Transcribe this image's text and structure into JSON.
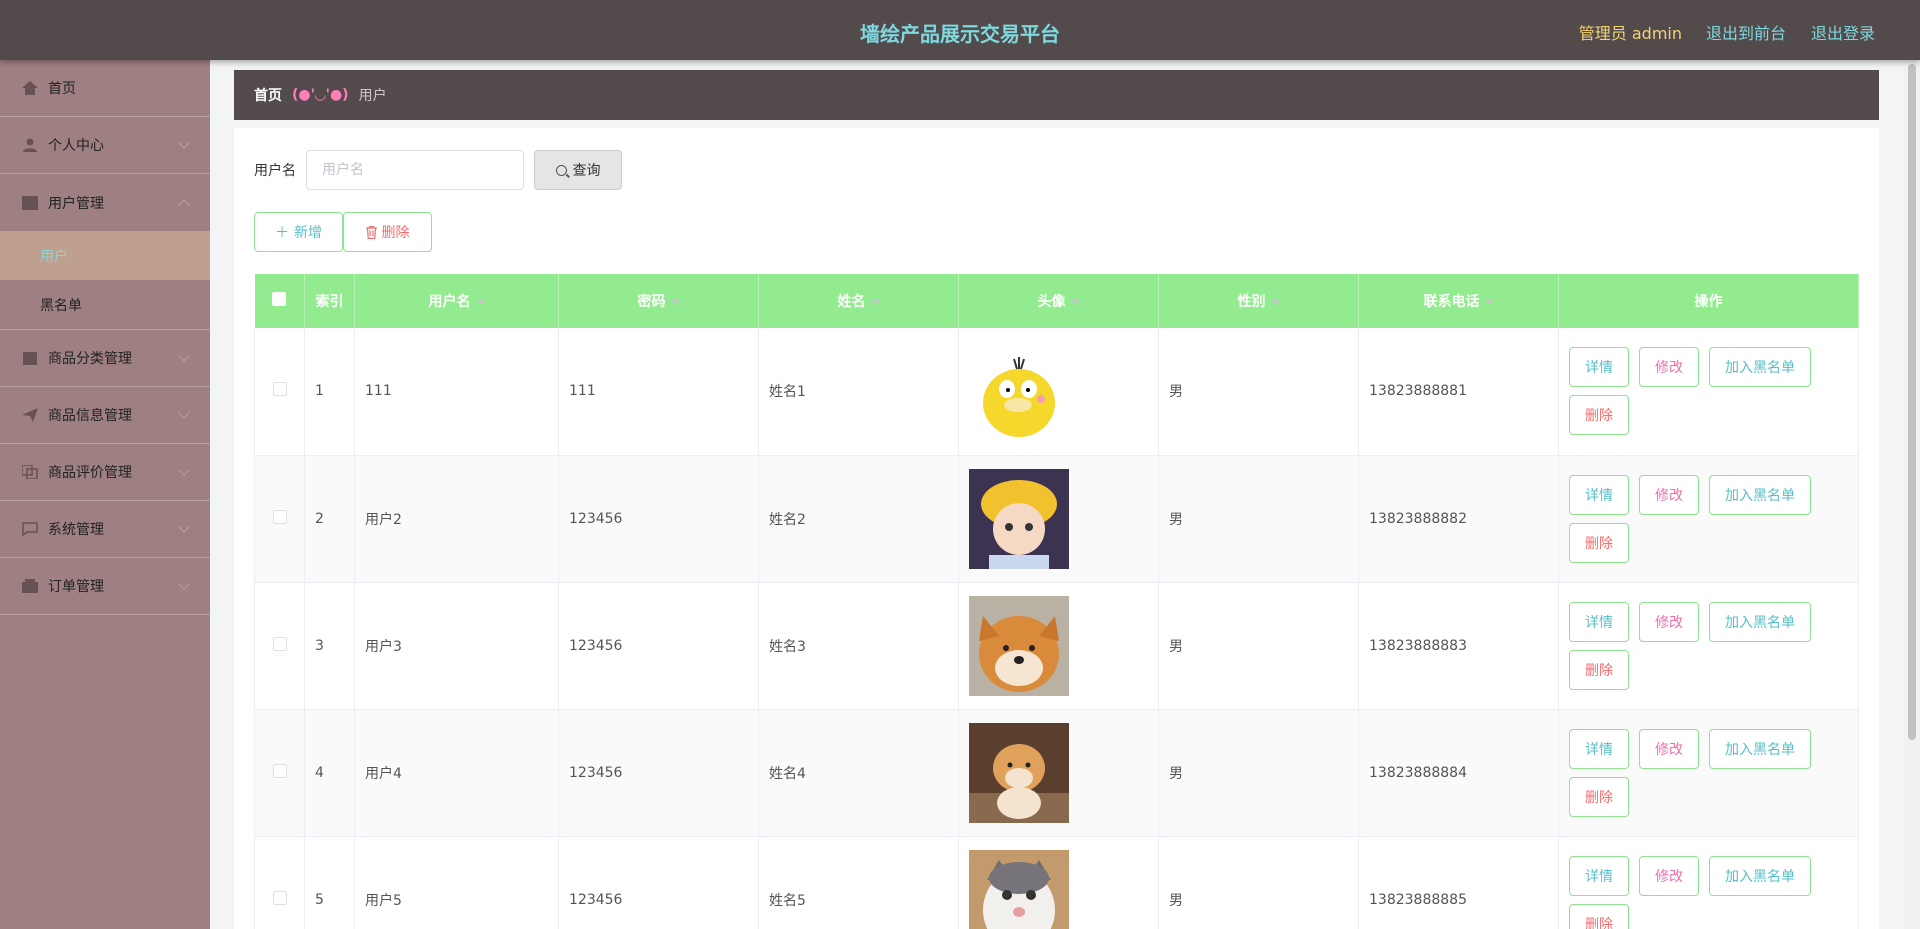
{
  "header": {
    "title": "墙绘产品展示交易平台",
    "user": "管理员 admin",
    "front_link": "退出到前台",
    "logout_link": "退出登录"
  },
  "sidebar": {
    "items": [
      {
        "label": "首页",
        "icon": "home-icon"
      },
      {
        "label": "个人中心",
        "icon": "user-icon"
      },
      {
        "label": "用户管理",
        "icon": "table-icon",
        "children": [
          "用户",
          "黑名单"
        ]
      },
      {
        "label": "商品分类管理",
        "icon": "building-icon"
      },
      {
        "label": "商品信息管理",
        "icon": "send-icon"
      },
      {
        "label": "商品评价管理",
        "icon": "copy-icon"
      },
      {
        "label": "系统管理",
        "icon": "chat-icon"
      },
      {
        "label": "订单管理",
        "icon": "box-icon"
      }
    ]
  },
  "breadcrumb": {
    "home": "首页",
    "separator": "(●'◡'●)",
    "current": "用户"
  },
  "search": {
    "label": "用户名",
    "placeholder": "用户名",
    "button": "查询"
  },
  "actions": {
    "add": "新增",
    "delete": "删除"
  },
  "table": {
    "columns": [
      "索引",
      "用户名",
      "密码",
      "姓名",
      "头像",
      "性别",
      "联系电话",
      "操作"
    ],
    "rows": [
      {
        "index": "1",
        "username": "111",
        "password": "111",
        "name": "姓名1",
        "avatar": "yellow-duck",
        "gender": "男",
        "phone": "13823888881"
      },
      {
        "index": "2",
        "username": "用户2",
        "password": "123456",
        "name": "姓名2",
        "avatar": "anime-boy",
        "gender": "男",
        "phone": "13823888882"
      },
      {
        "index": "3",
        "username": "用户3",
        "password": "123456",
        "name": "姓名3",
        "avatar": "shiba-dog",
        "gender": "男",
        "phone": "13823888883"
      },
      {
        "index": "4",
        "username": "用户4",
        "password": "123456",
        "name": "姓名4",
        "avatar": "shiba-puppy",
        "gender": "男",
        "phone": "13823888884"
      },
      {
        "index": "5",
        "username": "用户5",
        "password": "123456",
        "name": "姓名5",
        "avatar": "cat",
        "gender": "男",
        "phone": "13823888885"
      }
    ],
    "row_ops": {
      "detail": "详情",
      "edit": "修改",
      "blacklist": "加入黑名单",
      "remove": "删除"
    }
  },
  "colors": {
    "header_bg": "#534a4c",
    "title": "#7fd8de",
    "admin": "#f3d277",
    "sidebar_bg": "#9e7f82",
    "sidebar_active": "#bfa08f",
    "table_header": "#92ec8f"
  }
}
